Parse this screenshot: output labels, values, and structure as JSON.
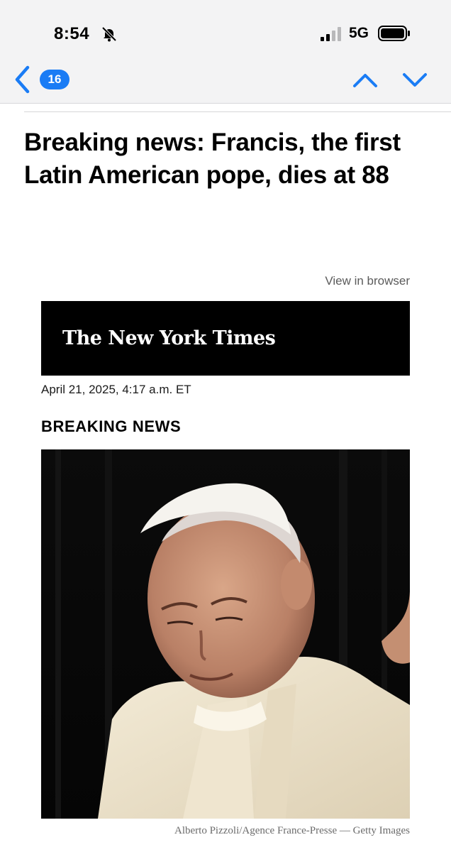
{
  "status_bar": {
    "time": "8:54",
    "network": "5G"
  },
  "nav": {
    "message_count": "16"
  },
  "email": {
    "subject": "Breaking news: Francis, the first Latin American pope, dies at 88",
    "view_in_browser": "View in browser",
    "masthead": "The New York Times",
    "dateline": "April 21, 2025, 4:17 a.m. ET",
    "kicker": "BREAKING NEWS",
    "photo_credit": "Alberto Pizzoli/Agence France-Presse — Getty Images"
  },
  "colors": {
    "accent": "#1a7cf5",
    "header_bg": "#f3f3f4",
    "masthead_bg": "#000000"
  },
  "icons": {
    "back": "chevron-left-icon",
    "previous": "chevron-up-icon",
    "next": "chevron-down-icon",
    "mute": "bell-slash-icon",
    "signal": "cellular-signal-icon",
    "battery": "battery-icon"
  }
}
